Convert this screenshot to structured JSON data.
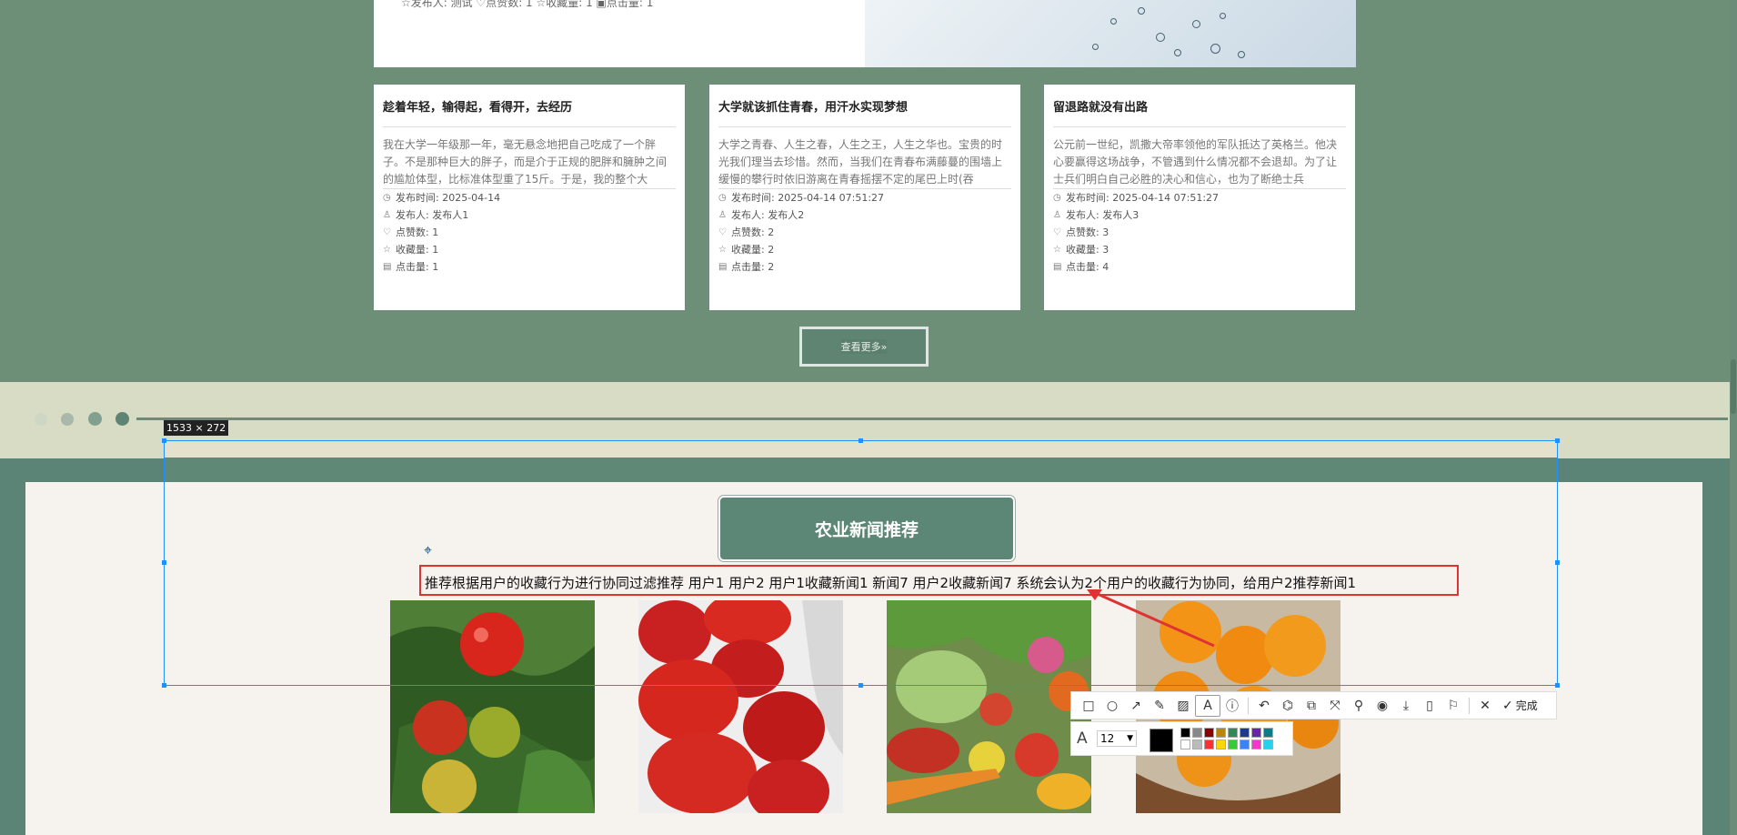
{
  "top_card": {
    "meta": "☆发布人: 测试   ♡点赞数: 1   ☆收藏量: 1   ▣点击量: 1"
  },
  "cards": [
    {
      "title": "趁着年轻，输得起，看得开，去经历",
      "desc": "我在大学一年级那一年，毫无悬念地把自己吃成了一个胖子。不是那种巨大的胖子，而是介于正规的肥胖和臃肿之间的尴尬体型，比标准体型重了15斤。于是，我的整个大",
      "rows": [
        {
          "label": "发布时间:",
          "value": "2025-04-14"
        },
        {
          "label": "发布人:",
          "value": "发布人1"
        },
        {
          "label": "点赞数:",
          "value": "1"
        },
        {
          "label": "收藏量:",
          "value": "1"
        },
        {
          "label": "点击量:",
          "value": "1"
        }
      ]
    },
    {
      "title": "大学就该抓住青春，用汗水实现梦想",
      "desc": "大学之青春、人生之春，人生之王，人生之华也。宝贵的时光我们理当去珍惜。然而，当我们在青春布满藤蔓的围墙上缓慢的攀行时依旧游离在青春摇摆不定的尾巴上时(吞",
      "rows": [
        {
          "label": "发布时间:",
          "value": "2025-04-14 07:51:27"
        },
        {
          "label": "发布人:",
          "value": "发布人2"
        },
        {
          "label": "点赞数:",
          "value": "2"
        },
        {
          "label": "收藏量:",
          "value": "2"
        },
        {
          "label": "点击量:",
          "value": "2"
        }
      ]
    },
    {
      "title": "留退路就没有出路",
      "desc": "公元前一世纪，凯撒大帝率领他的军队抵达了英格兰。他决心要赢得这场战争，不管遇到什么情况都不会退却。为了让士兵们明白自己必胜的决心和信心，也为了断绝士兵",
      "rows": [
        {
          "label": "发布时间:",
          "value": "2025-04-14 07:51:27"
        },
        {
          "label": "发布人:",
          "value": "发布人3"
        },
        {
          "label": "点赞数:",
          "value": "3"
        },
        {
          "label": "收藏量:",
          "value": "3"
        },
        {
          "label": "点击量:",
          "value": "4"
        }
      ]
    }
  ],
  "more_button": "查看更多»",
  "section_title": "农业新闻推荐",
  "recommend_text": "推荐根据用户的收藏行为进行协同过滤推荐 用户1 用户2 用户1收藏新闻1 新闻7 用户2收藏新闻7 系统会认为2个用户的收藏行为协同，给用户2推荐新闻1",
  "images": [
    "tomato",
    "strawberry",
    "vegetables",
    "loquat"
  ],
  "screenshot_tool": {
    "size_label": "1533 × 272",
    "done_label": "完成",
    "font_size": "12",
    "tools": [
      "rectangle-icon",
      "circle-icon",
      "arrow-icon",
      "pen-icon",
      "mosaic-icon",
      "text-icon",
      "number-icon",
      "undo-icon",
      "ocr-icon",
      "translate-icon",
      "scroll-icon",
      "pin-icon",
      "record-icon",
      "download-icon",
      "save-icon",
      "bookmark-icon",
      "close-icon"
    ]
  },
  "colors": {
    "accent": "#5c8676",
    "annotation": "#dd3333",
    "selection": "#1e90ff"
  }
}
